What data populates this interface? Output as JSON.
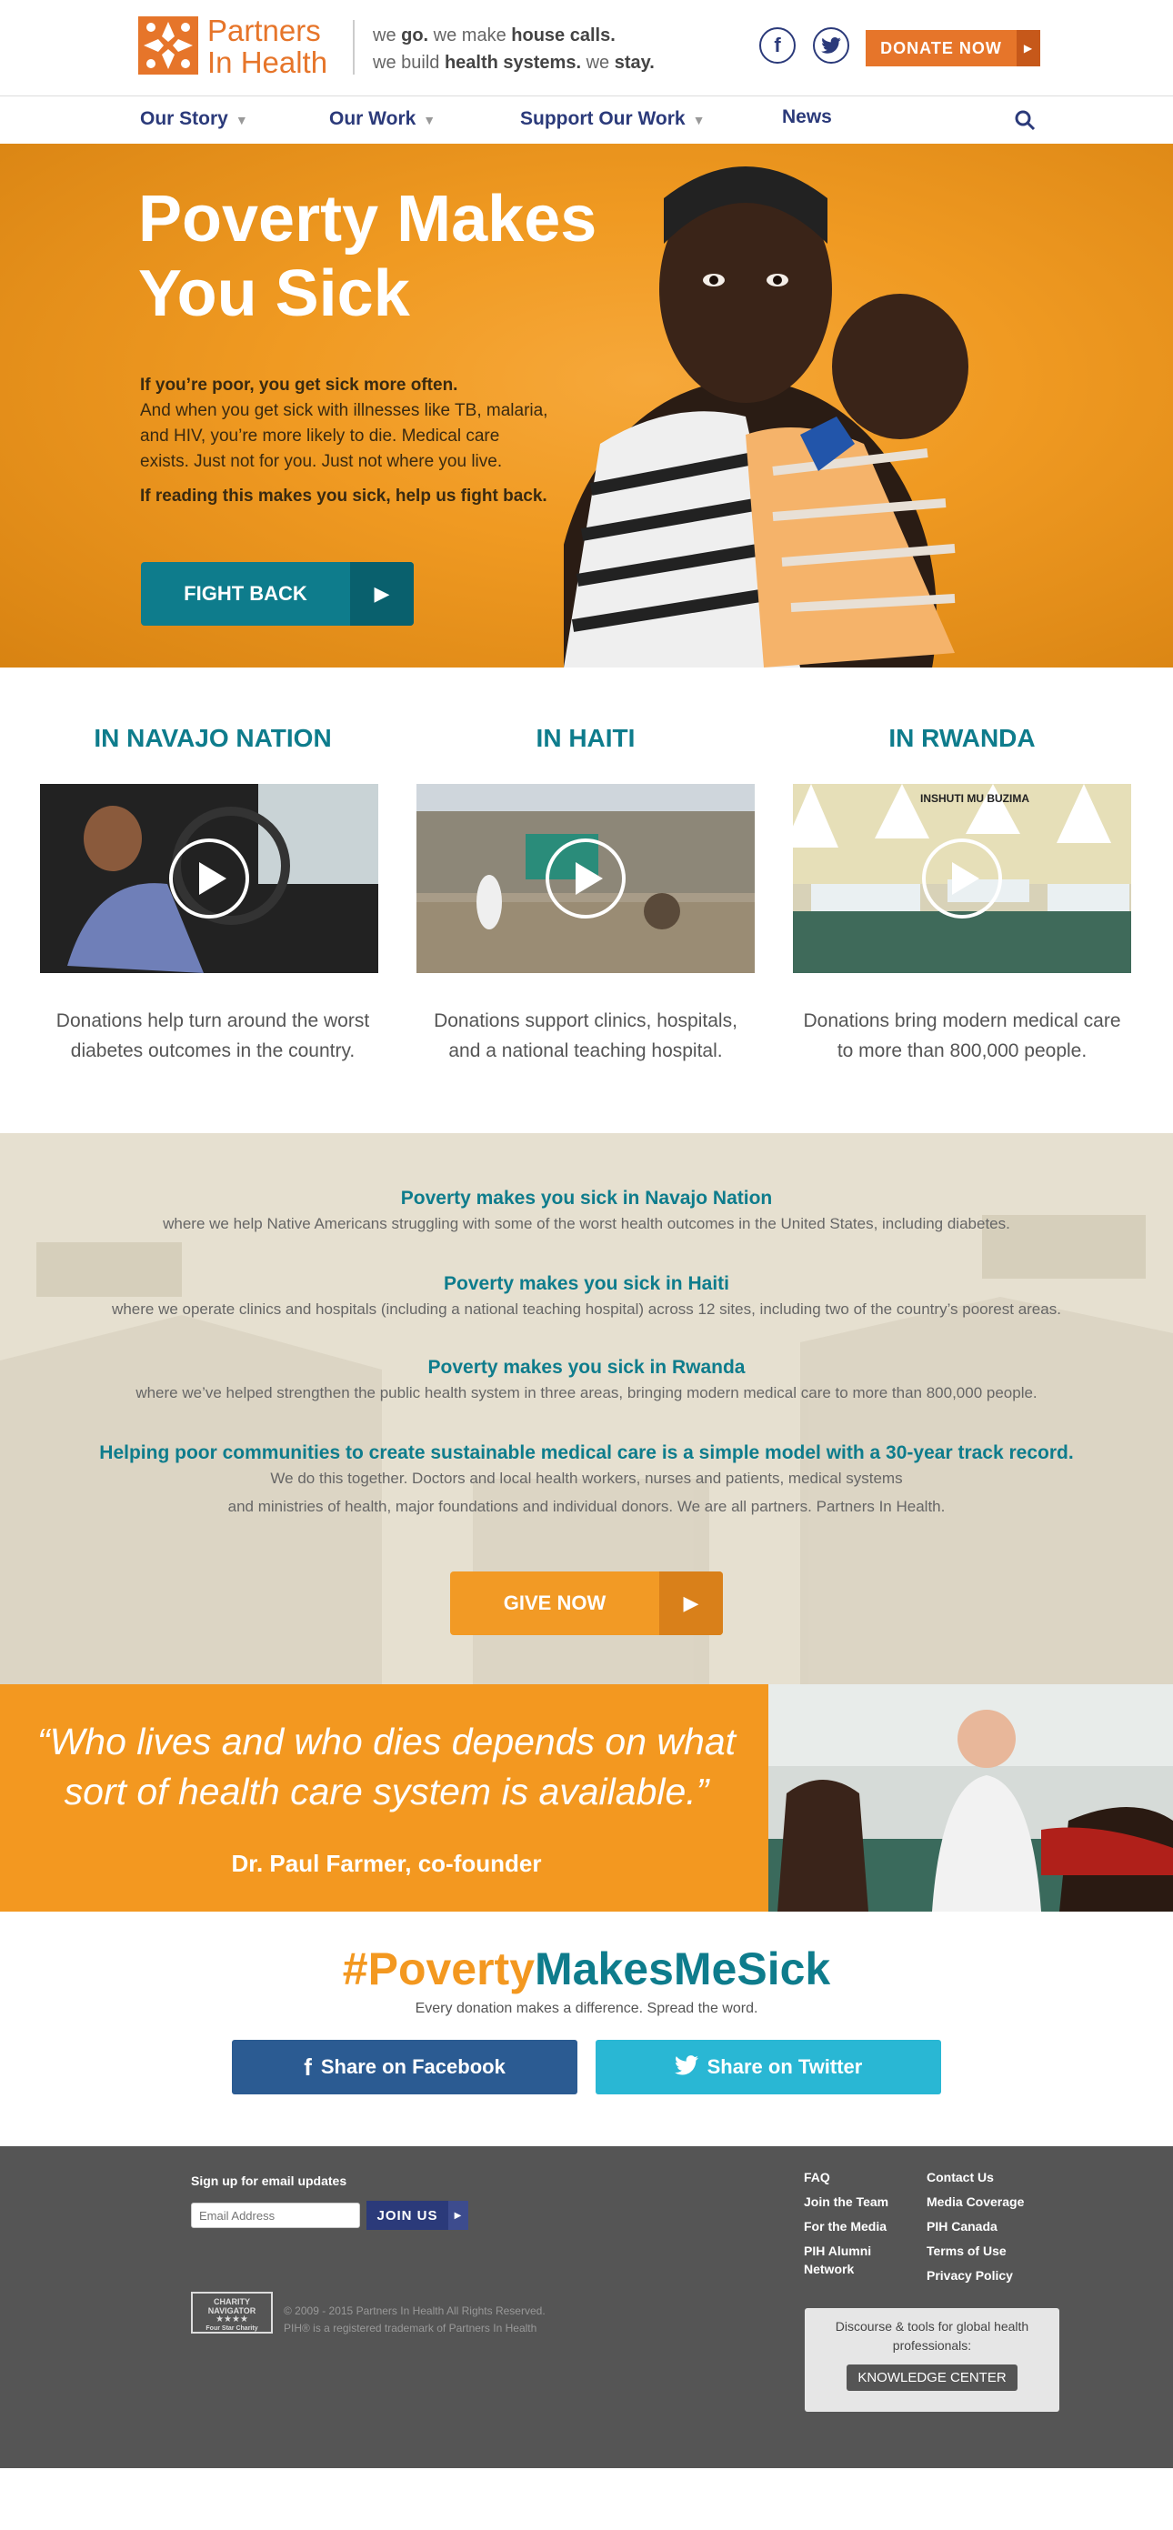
{
  "header": {
    "logo_line1": "Partners",
    "logo_line2": "In Health",
    "tagline_line1": [
      "we ",
      "go.",
      " we make ",
      "house calls."
    ],
    "tagline_line2": [
      "we build ",
      "health systems.",
      " we ",
      "stay."
    ],
    "facebook_glyph": "f",
    "twitter_glyph": "t",
    "donate_label": "DONATE NOW"
  },
  "nav": {
    "items": [
      {
        "label": "Our Story",
        "has_dropdown": true
      },
      {
        "label": "Our Work",
        "has_dropdown": true
      },
      {
        "label": "Support Our Work",
        "has_dropdown": true
      },
      {
        "label": "News",
        "has_dropdown": false
      }
    ],
    "search_icon": "search-icon"
  },
  "hero": {
    "title_line1": "Poverty Makes",
    "title_line2": "You Sick",
    "lead_bold": "If you’re poor, you get sick more often.",
    "lead_rest": "And when you get sick with illnesses like TB, malaria, and HIV, you’re more likely to die. Medical care exists. Just not for you. Just not where you live.",
    "cta_text": "If reading this makes you sick, help us fight back.",
    "button_label": "FIGHT BACK"
  },
  "regions": [
    {
      "title": "IN NAVAJO NATION",
      "desc": "Donations help turn around the worst diabetes outcomes in the country."
    },
    {
      "title": "IN HAITI",
      "desc": "Donations support clinics, hospitals, and a national teaching hospital."
    },
    {
      "title": "IN RWANDA",
      "desc": "Donations bring modern medical care to more than 800,000 people."
    }
  ],
  "rwanda_photo_sign": "INSHUTI   MU   BUZIMA",
  "band": {
    "items": [
      {
        "heading": "Poverty makes you sick in Navajo Nation",
        "text": "where we help Native Americans struggling with some of the worst health outcomes in the United States, including diabetes."
      },
      {
        "heading": "Poverty makes you sick in Haiti",
        "text": "where we operate clinics and hospitals (including a national teaching hospital) across 12 sites, including two of the country’s poorest areas."
      },
      {
        "heading": "Poverty makes you sick in Rwanda",
        "text": "where we’ve helped strengthen the public health system in three areas, bringing modern medical care to more than 800,000 people."
      },
      {
        "heading": "Helping poor communities to create sustainable medical care is a simple model with a 30-year track record.",
        "text_line1": "We do this together. Doctors and local health workers, nurses and patients, medical systems",
        "text_line2": "and ministries of health, major foundations and individual donors. We are all partners. Partners In Health."
      }
    ],
    "button_label": "GIVE NOW"
  },
  "quote": {
    "line1": "“Who lives and who dies depends on what",
    "line2": "sort of health care system is available.”",
    "attribution": "Dr. Paul Farmer, co-founder"
  },
  "share": {
    "hashtag_part1": "#Poverty",
    "hashtag_part2": "MakesMeSick",
    "subtitle": "Every donation makes a difference. Spread the word.",
    "facebook_label": "Share on Facebook",
    "twitter_label": "Share on Twitter",
    "facebook_color": "#2b5b92",
    "twitter_color": "#29b7d4"
  },
  "footer": {
    "signup_label": "Sign up for email updates",
    "email_placeholder": "Email Address",
    "join_label": "JOIN US",
    "charity_badge": [
      "CHARITY",
      "NAVIGATOR",
      "★★★★",
      "Four Star Charity"
    ],
    "copyright_line1": "© 2009 - 2015 Partners In Health All Rights Reserved.",
    "copyright_line2": "PIH® is a registered trademark of Partners In Health",
    "links_col1": [
      "FAQ",
      "Join the Team",
      "For the Media",
      "PIH Alumni Network"
    ],
    "links_col2": [
      "Contact Us",
      "Media Coverage",
      "PIH Canada",
      "Terms of Use",
      "Privacy Policy"
    ],
    "kc_text": "Discourse & tools for global health professionals:",
    "kc_button": "KNOWLEDGE CENTER"
  },
  "colors": {
    "brand_orange": "#e6752a",
    "hero_orange": "#f09a22",
    "teal": "#0e7c8c",
    "navy": "#2b3a7a",
    "footer_gray": "#555555"
  }
}
